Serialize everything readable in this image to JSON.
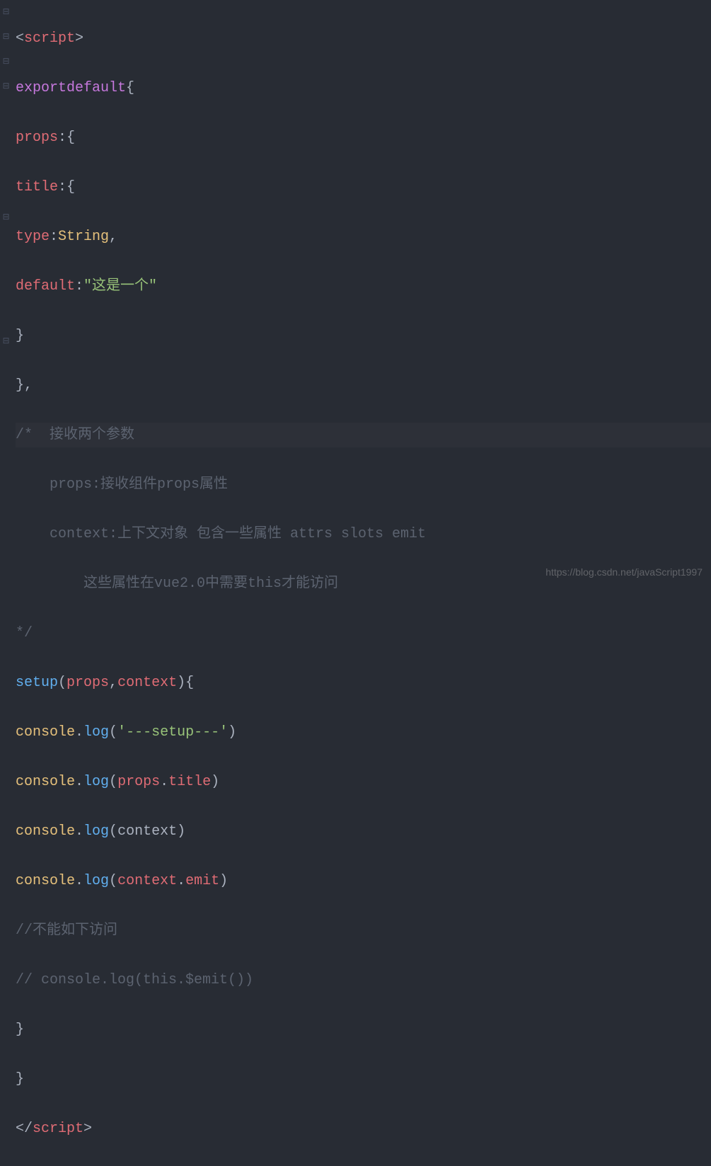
{
  "code": {
    "tag_open_bracket": "<",
    "tag_close_bracket": ">",
    "tag_end_open": "</",
    "script_tag": "script",
    "export": "export",
    "default": "default",
    "brace_open": "{",
    "brace_close": "}",
    "brace_close_comma": "},",
    "props_key": "props",
    "title_key": "title",
    "type_key": "type",
    "default_key": "default",
    "colon": ":",
    "comma": ",",
    "string_type": "String",
    "string_default_val": "\"这是一个\"",
    "comment_block_1": "/*  接收两个参数",
    "comment_block_2": "    props:接收组件props属性",
    "comment_block_3": "    context:上下文对象 包含一些属性 attrs slots emit",
    "comment_block_4": "        这些属性在vue2.0中需要this才能访问",
    "comment_block_5": "*/",
    "setup": "setup",
    "paren_open": "(",
    "paren_close": ")",
    "param_props": "props",
    "param_context": "context",
    "console": "console",
    "dot": ".",
    "log": "log",
    "str_setup_log": "'---setup---'",
    "prop_title": "title",
    "prop_emit": "emit",
    "comment_line_1": "//不能如下访问",
    "comment_line_2": "// console.log(this.$emit())"
  },
  "watermark": "https://blog.csdn.net/javaScript1997"
}
